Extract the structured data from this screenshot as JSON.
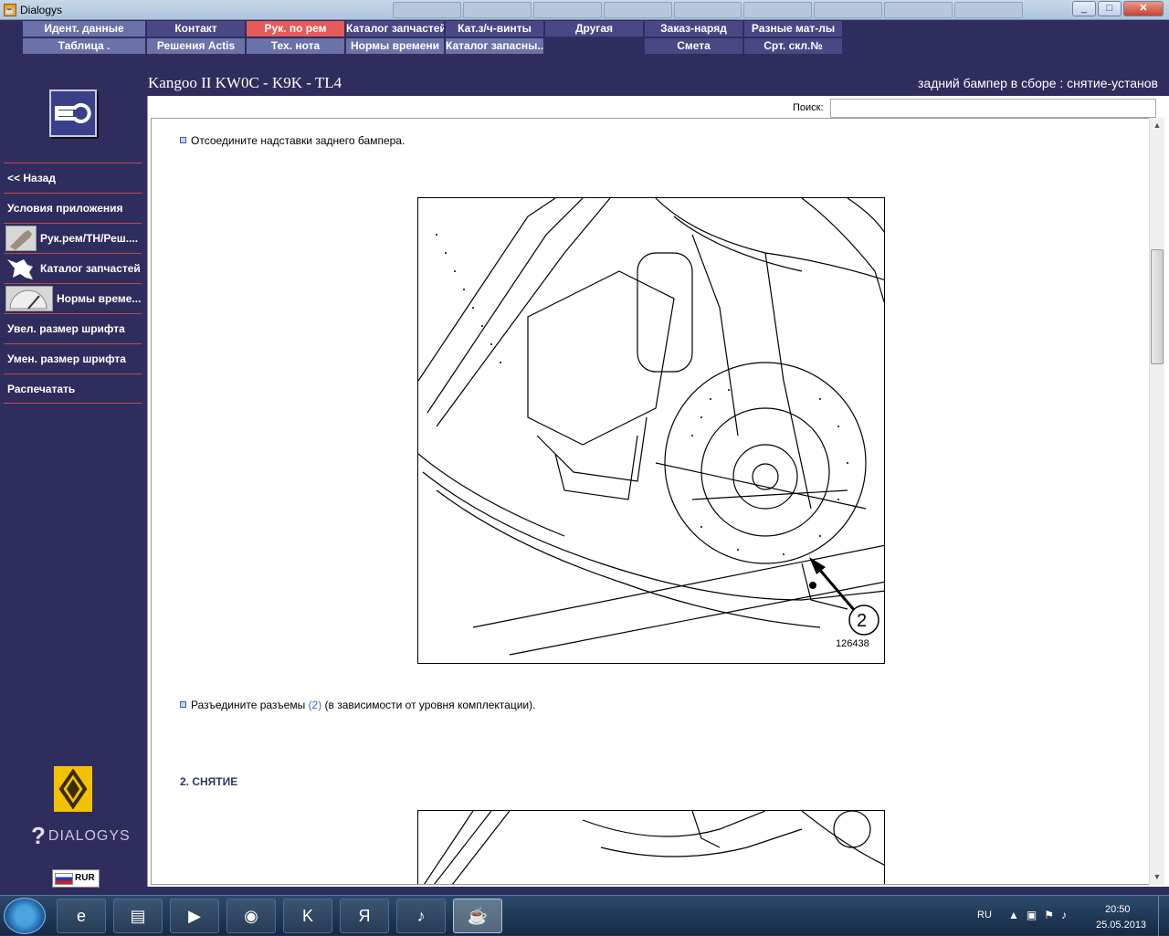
{
  "window": {
    "title": "Dialogys"
  },
  "menu": {
    "row1": [
      "Идент. данные",
      "Контакт",
      "Рук. по рем",
      "Каталог запчастей",
      "Кат.з/ч-винты",
      "Другая",
      "Заказ-наряд",
      "Разные мат-лы"
    ],
    "row2": [
      "Таблица .",
      "Решения Actis",
      "Тех. нота",
      "Нормы времени",
      "Каталог запасны...",
      "",
      "Смета",
      "Срт. скл.№"
    ],
    "active": "Рук. по рем"
  },
  "header": {
    "vehicle": "Kangoo II KW0C - K9K - TL4",
    "operation": "задний бампер в сборе : снятие-установ"
  },
  "sidebar": {
    "items": [
      {
        "label": "<< Назад",
        "icon": ""
      },
      {
        "label": "Условия приложения",
        "icon": ""
      },
      {
        "label": "Рук.рем/ТН/Реш....",
        "icon": "repair-manual-icon"
      },
      {
        "label": "Каталог запчастей",
        "icon": "parts-catalog-icon"
      },
      {
        "label": "Нормы време...",
        "icon": "time-norms-icon"
      },
      {
        "label": "Увел. размер шрифта",
        "icon": ""
      },
      {
        "label": "Умен. размер шрифта",
        "icon": ""
      },
      {
        "label": "Распечатать",
        "icon": ""
      }
    ],
    "brand": "DIALOGYS",
    "currency": "RUR"
  },
  "search": {
    "label": "Поиск:",
    "value": ""
  },
  "document": {
    "step1": "Отсоедините надставки заднего бампера.",
    "figure1": {
      "callout": "2",
      "code": "126438"
    },
    "step2_before": "Разъедините разъемы ",
    "step2_link": "(2)",
    "step2_after": " (в зависимости от уровня комплектации).",
    "section": "2. СНЯТИЕ"
  },
  "taskbar": {
    "apps": [
      "ie-icon",
      "explorer-icon",
      "media-player-icon",
      "chrome-icon",
      "kaspersky-icon",
      "yandex-icon",
      "volume-app-icon",
      "java-icon"
    ],
    "lang": "RU",
    "time": "20:50",
    "date": "25.05.2013"
  }
}
